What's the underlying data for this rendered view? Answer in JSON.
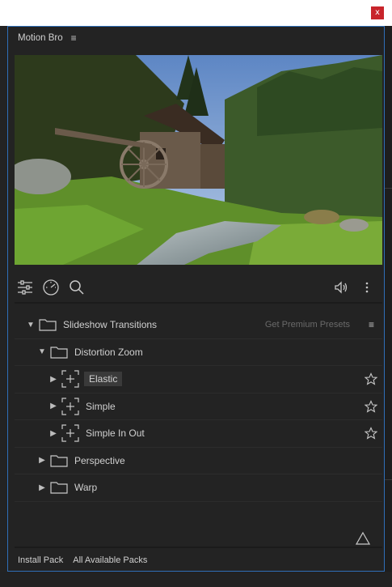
{
  "window": {
    "close_glyph": "x"
  },
  "panel": {
    "title": "Motion Bro",
    "menu_glyph": "≡"
  },
  "toolbar": {
    "icons": [
      "sliders-icon",
      "speedometer-icon",
      "search-icon",
      "volume-icon",
      "more-vert-icon"
    ]
  },
  "tree": {
    "root": {
      "label": "Slideshow Transitions",
      "action": "Get Premium Presets",
      "menu_glyph": "≡"
    },
    "group": {
      "label": "Distortion Zoom"
    },
    "presets": [
      {
        "label": "Elastic"
      },
      {
        "label": "Simple"
      },
      {
        "label": "Simple In Out"
      }
    ],
    "folders": [
      {
        "label": "Perspective"
      },
      {
        "label": "Warp"
      }
    ]
  },
  "footer": {
    "install": "Install Pack",
    "all_packs": "All Available Packs"
  },
  "colors": {
    "accent": "#2f6fb8",
    "close": "#c8242b"
  }
}
